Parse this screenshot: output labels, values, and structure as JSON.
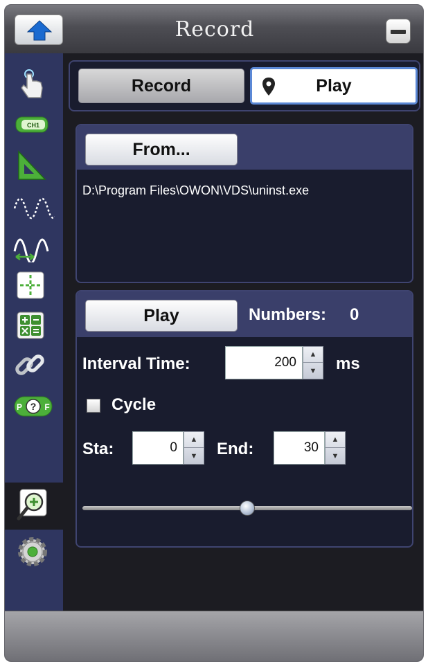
{
  "window": {
    "title": "Record"
  },
  "tabs": {
    "record_label": "Record",
    "play_label": "Play",
    "selected": "Play"
  },
  "source": {
    "from_label": "From...",
    "file_path": "D:\\Program Files\\OWON\\VDS\\uninst.exe"
  },
  "playback": {
    "play_label": "Play",
    "numbers_label": "Numbers:",
    "numbers_value": "0",
    "interval_label": "Interval Time:",
    "interval_value": "200",
    "interval_unit": "ms",
    "cycle_label": "Cycle",
    "cycle_checked": false,
    "start_label": "Sta:",
    "start_value": "0",
    "end_label": "End:",
    "end_value": "30",
    "slider_position": 0.5
  },
  "sidebar": {
    "items": [
      {
        "icon": "touch-hand-icon"
      },
      {
        "icon": "ch1-channel-icon"
      },
      {
        "icon": "trigger-ruler-icon"
      },
      {
        "icon": "waveform-icon"
      },
      {
        "icon": "measure-waveform-icon"
      },
      {
        "icon": "cursor-crosshair-icon"
      },
      {
        "icon": "math-calculator-icon"
      },
      {
        "icon": "link-icon"
      },
      {
        "icon": "pass-fail-icon"
      },
      {
        "icon": "zoom-record-icon",
        "active": true
      },
      {
        "icon": "settings-gear-icon"
      }
    ]
  },
  "colors": {
    "sidebar_bg": "#2f3660",
    "panel_bg": "#191c2e",
    "panel_header": "#3a3f6a",
    "selected_border": "#5b88d6"
  }
}
